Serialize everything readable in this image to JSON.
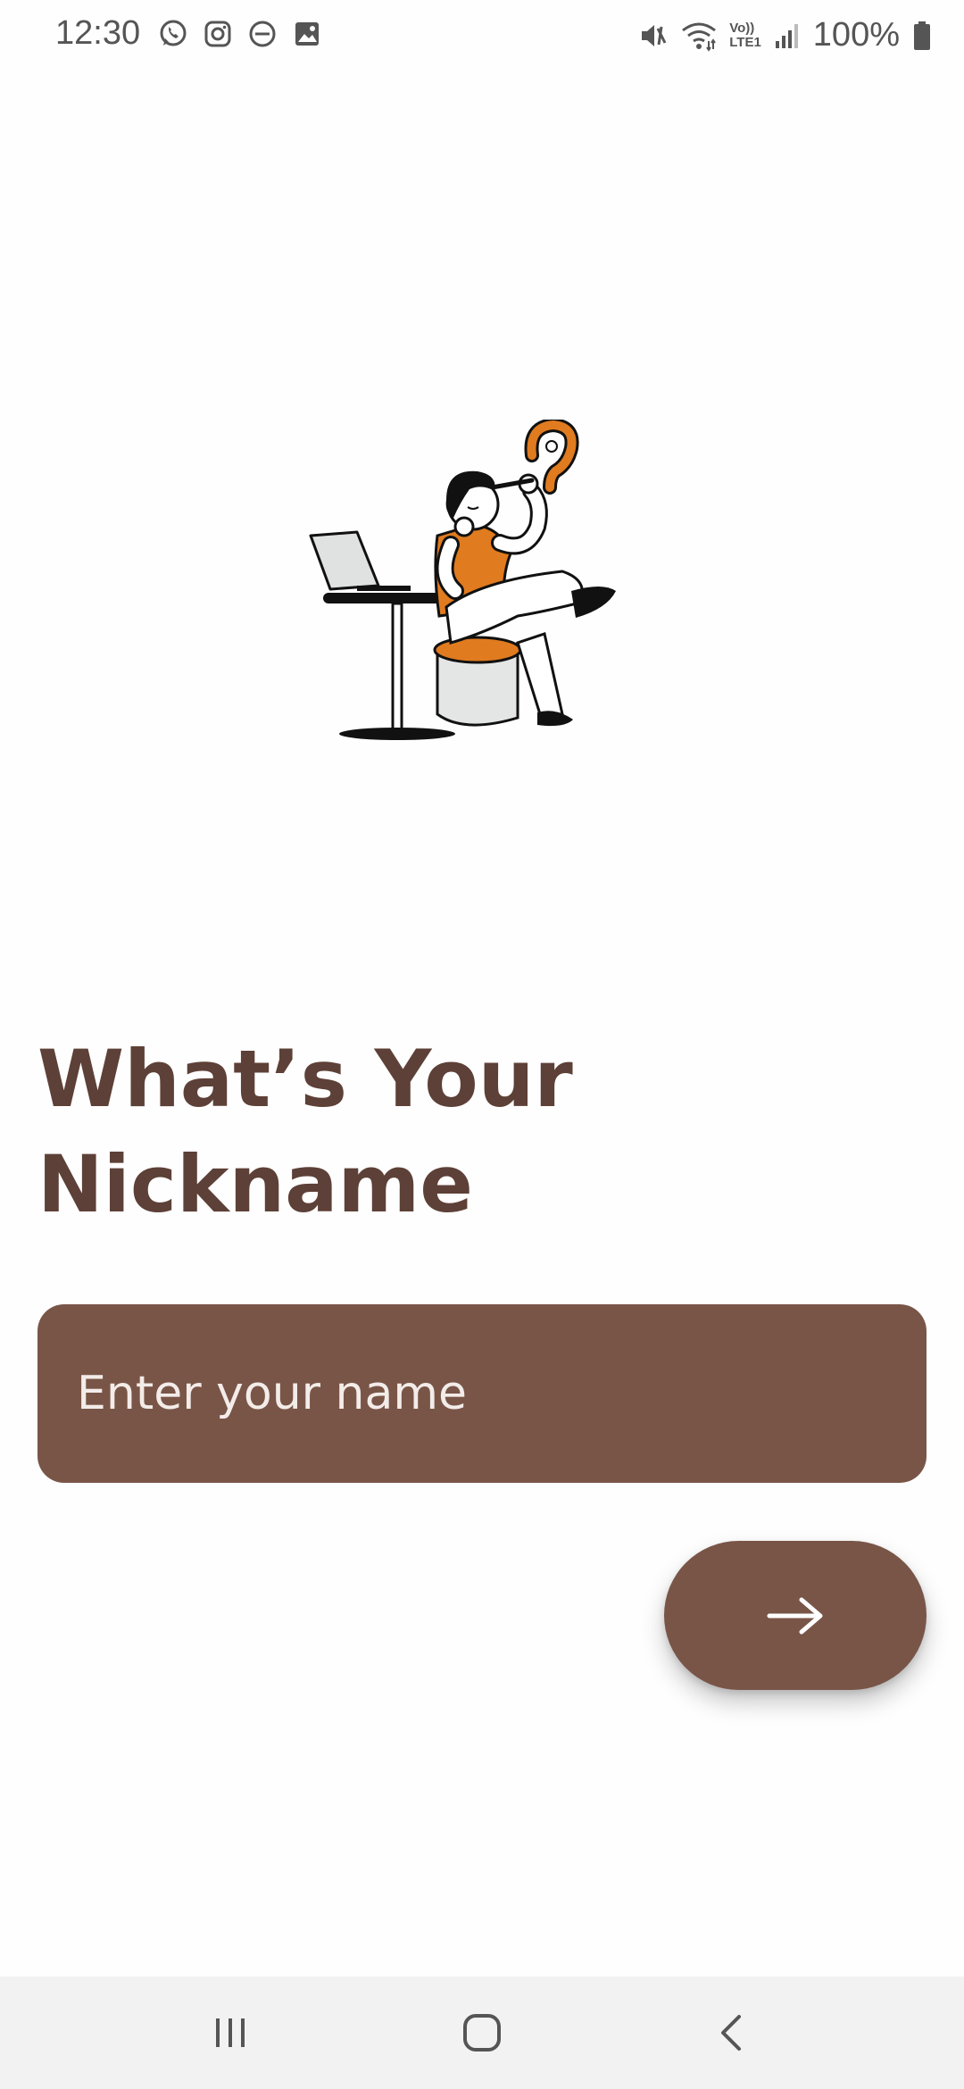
{
  "status_bar": {
    "time": "12:30",
    "left_icons": [
      "whatsapp-icon",
      "instagram-icon",
      "do-not-disturb-icon",
      "gallery-icon"
    ],
    "right_icons": [
      "mute-icon",
      "wifi-icon",
      "volte-lte-icon",
      "signal-icon",
      "battery-icon"
    ],
    "volte_label": "Vo))",
    "lte_label": "LTE1",
    "battery": "100%"
  },
  "screen": {
    "title_line1": "What’s Your",
    "title_line2": "Nickname",
    "name_input": {
      "value": "",
      "placeholder": "Enter your name"
    },
    "next_button_icon": "arrow-right-icon"
  },
  "nav_bar": {
    "items": [
      "recent-apps-icon",
      "home-icon",
      "back-icon"
    ]
  },
  "colors": {
    "primary": "#795548",
    "title": "#5d4037",
    "accent": "#e07b1f",
    "background": "#fefefe"
  }
}
